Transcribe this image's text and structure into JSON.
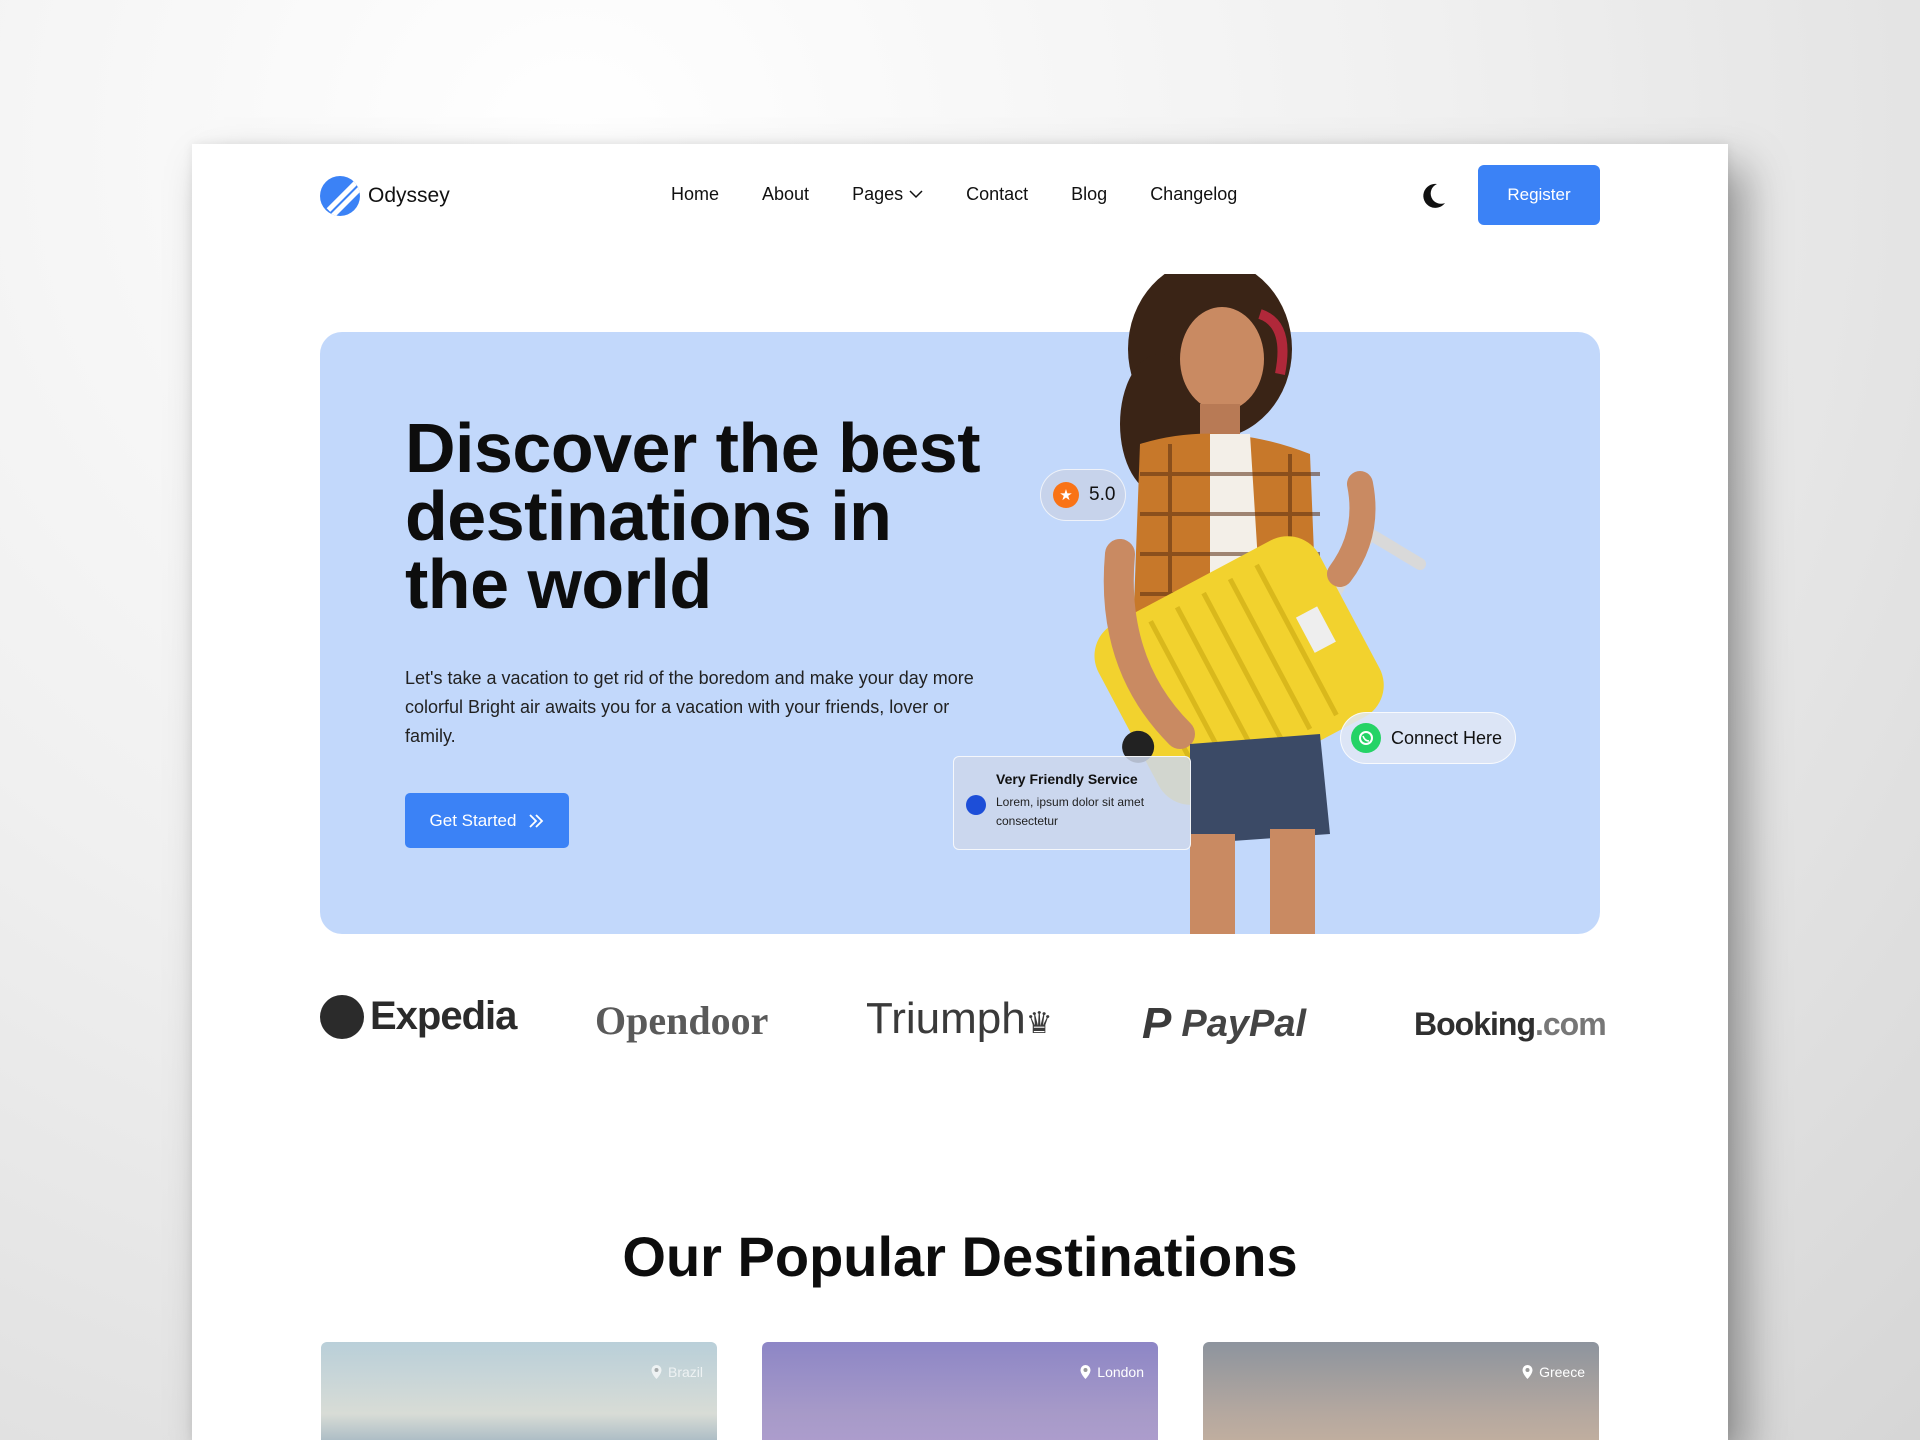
{
  "brand": {
    "name": "Odyssey"
  },
  "nav": {
    "items": [
      {
        "label": "Home"
      },
      {
        "label": "About"
      },
      {
        "label": "Pages"
      },
      {
        "label": "Contact"
      },
      {
        "label": "Blog"
      },
      {
        "label": "Changelog"
      }
    ],
    "register_label": "Register",
    "theme_icon": "moon-icon"
  },
  "hero": {
    "title": "Discover the best destinations in the world",
    "description": "Let's take a vacation to get rid of the boredom and make your day more colorful Bright air awaits you for a vacation with your friends, lover or family.",
    "cta_label": "Get Started",
    "rating": "5.0",
    "connect_label": "Connect Here",
    "service_title": "Very Friendly Service",
    "service_text": "Lorem, ipsum dolor sit amet consectetur"
  },
  "partners": {
    "expedia": "Expedia",
    "opendoor": "Opendoor",
    "triumph": "Triumph",
    "paypal": "PayPal",
    "booking_main": "Booking",
    "booking_suffix": ".com"
  },
  "destinations": {
    "title": "Our Popular Destinations",
    "cards": [
      {
        "location": "Brazil"
      },
      {
        "location": "London"
      },
      {
        "location": "Greece"
      }
    ]
  },
  "colors": {
    "accent": "#3b82f6",
    "hero_bg": "#c2d8fb"
  }
}
